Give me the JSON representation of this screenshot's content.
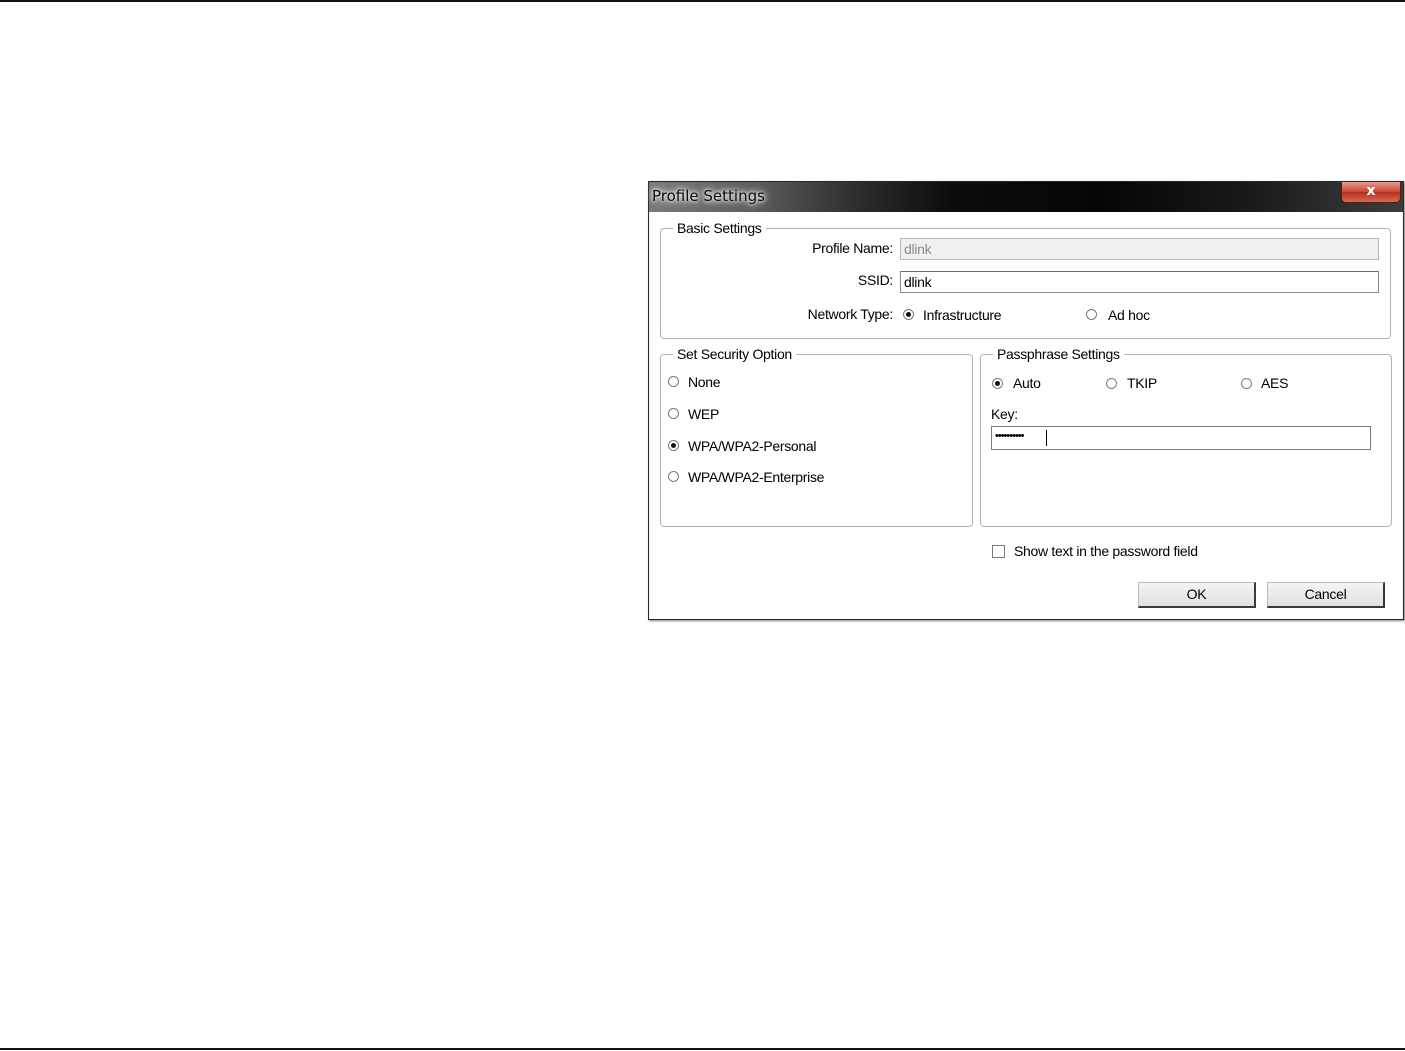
{
  "dialog": {
    "title": "Profile Settings",
    "close_glyph": "x"
  },
  "basic": {
    "legend": "Basic Settings",
    "profile_name_label": "Profile Name:",
    "profile_name_value": "dlink",
    "ssid_label": "SSID:",
    "ssid_value": "dlink",
    "network_type_label": "Network Type:",
    "network_types": [
      {
        "label": "Infrastructure",
        "selected": true
      },
      {
        "label": "Ad hoc",
        "selected": false
      }
    ]
  },
  "security": {
    "legend": "Set Security Option",
    "options": [
      {
        "label": "None",
        "selected": false
      },
      {
        "label": "WEP",
        "selected": false
      },
      {
        "label": "WPA/WPA2-Personal",
        "selected": true
      },
      {
        "label": "WPA/WPA2-Enterprise",
        "selected": false
      }
    ]
  },
  "passphrase": {
    "legend": "Passphrase Settings",
    "ciphers": [
      {
        "label": "Auto",
        "selected": true
      },
      {
        "label": "TKIP",
        "selected": false
      },
      {
        "label": "AES",
        "selected": false
      }
    ],
    "key_label": "Key:",
    "key_value": "••••••••••"
  },
  "show_text": {
    "label": "Show text in the password field",
    "checked": false
  },
  "buttons": {
    "ok": "OK",
    "cancel": "Cancel"
  }
}
